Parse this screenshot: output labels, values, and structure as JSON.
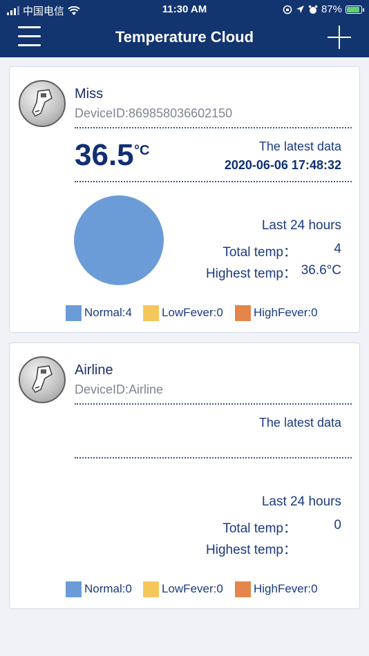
{
  "status_bar": {
    "carrier": "中国电信",
    "time": "11:30 AM",
    "battery_percent": "87%",
    "battery_level": 0.87
  },
  "header": {
    "title": "Temperature Cloud",
    "menu_icon": "hamburger-menu-icon",
    "add_icon": "plus-icon"
  },
  "colors": {
    "header_bg": "#12346f",
    "normal": "#6b9cd8",
    "low_fever": "#f5c75a",
    "high_fever": "#e4864a"
  },
  "devices": [
    {
      "name": "Miss",
      "device_id": "DeviceID:869858036602150",
      "temperature": "36.5",
      "temperature_unit": "°C",
      "latest_label": "The latest data",
      "latest_datetime": "2020-06-06 17:48:32",
      "last24_label": "Last 24 hours",
      "total_label": "Total temp：",
      "total_value": "4",
      "highest_label": "Highest temp：",
      "highest_value": "36.6°C",
      "legend": {
        "normal": "Normal:4",
        "low_fever": "LowFever:0",
        "high_fever": "HighFever:0"
      },
      "pie_data": {
        "normal": 4,
        "low_fever": 0,
        "high_fever": 0
      }
    },
    {
      "name": "Airline",
      "device_id": "DeviceID:Airline",
      "temperature": "",
      "temperature_unit": "",
      "latest_label": "The latest data",
      "latest_datetime": "",
      "last24_label": "Last 24 hours",
      "total_label": "Total temp：",
      "total_value": "0",
      "highest_label": "Highest temp：",
      "highest_value": "",
      "legend": {
        "normal": "Normal:0",
        "low_fever": "LowFever:0",
        "high_fever": "HighFever:0"
      },
      "pie_data": {
        "normal": 0,
        "low_fever": 0,
        "high_fever": 0
      }
    }
  ]
}
